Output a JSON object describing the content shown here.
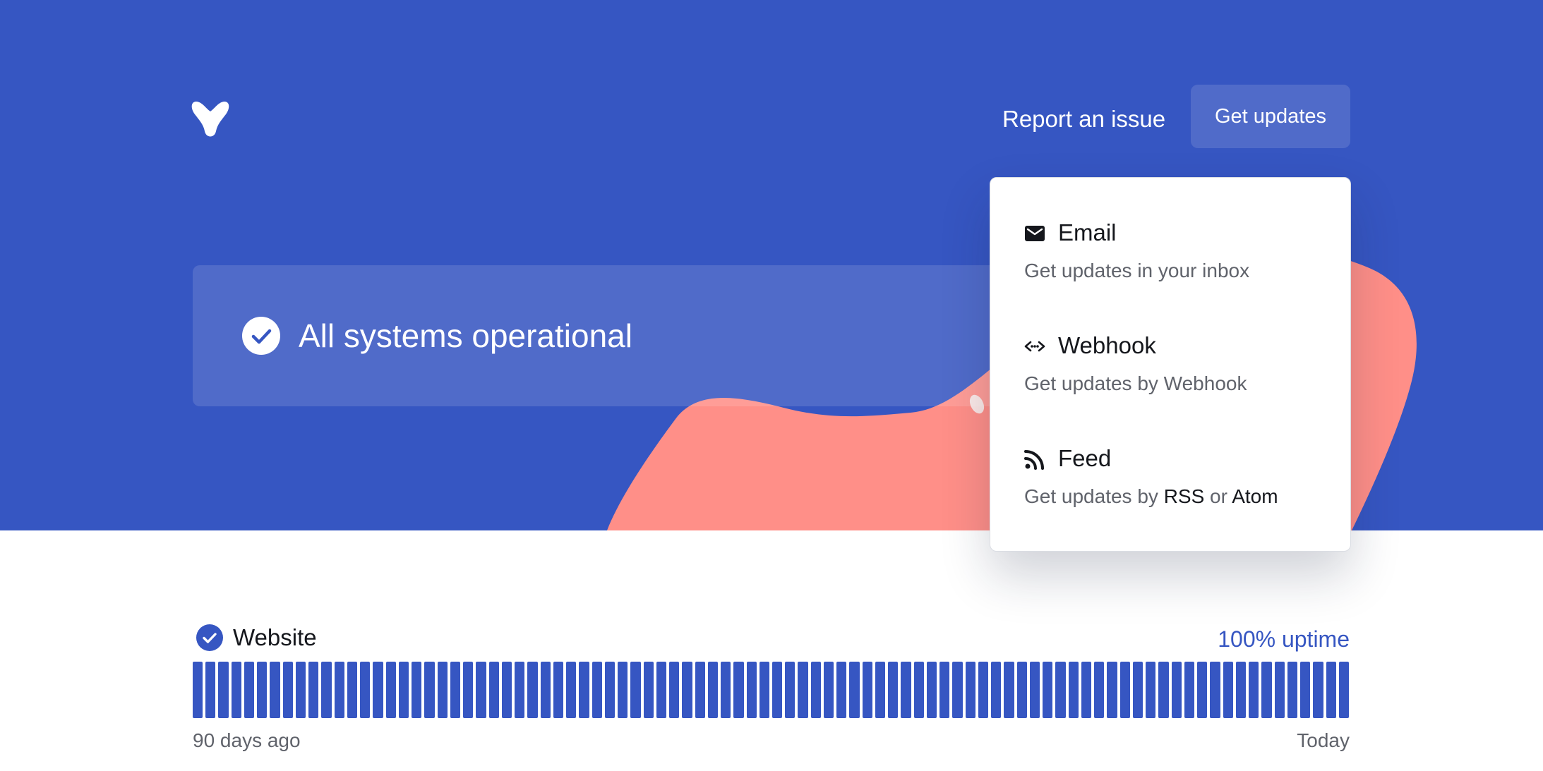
{
  "header": {
    "report_label": "Report an issue",
    "updates_label": "Get updates"
  },
  "status": {
    "text": "All systems operational"
  },
  "dropdown": {
    "items": [
      {
        "icon": "mail-icon",
        "title": "Email",
        "description": "Get updates in your inbox"
      },
      {
        "icon": "webhook-icon",
        "title": "Webhook",
        "description": "Get updates by Webhook"
      },
      {
        "icon": "rss-icon",
        "title": "Feed",
        "description_prefix": "Get updates by",
        "link_rss": "RSS",
        "description_middle": "or",
        "link_atom": "Atom"
      }
    ]
  },
  "monitor": {
    "name": "Website",
    "uptime": "100% uptime",
    "days": 90,
    "bar_status": "operational",
    "start_label": "90 days ago",
    "end_label": "Today"
  },
  "colors": {
    "brand": "#3656c2",
    "blob": "#ff8f88",
    "text_dark": "#15171c",
    "text_muted": "#60636b"
  }
}
